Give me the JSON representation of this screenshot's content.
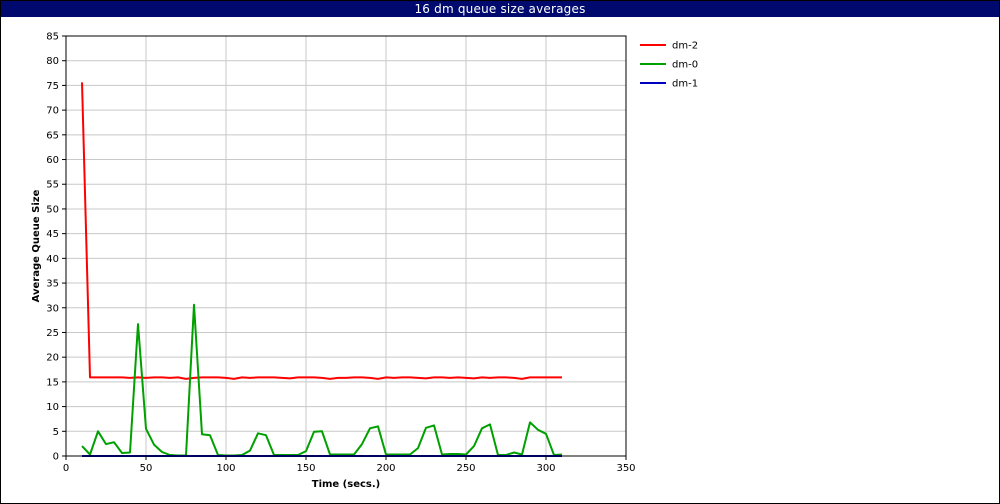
{
  "chart_data": {
    "type": "line",
    "title": "16 dm queue size averages",
    "xlabel": "Time (secs.)",
    "ylabel": "Average Queue Size",
    "xlim": [
      0,
      350
    ],
    "ylim": [
      0,
      85
    ],
    "x_ticks": [
      0,
      50,
      100,
      150,
      200,
      250,
      300,
      350
    ],
    "y_ticks": [
      0,
      5,
      10,
      15,
      20,
      25,
      30,
      35,
      40,
      45,
      50,
      55,
      60,
      65,
      70,
      75,
      80,
      85
    ],
    "grid": true,
    "legend_position": "right",
    "series": [
      {
        "name": "dm-2",
        "color": "#ff0000",
        "x": [
          10,
          15,
          20,
          25,
          30,
          35,
          40,
          45,
          50,
          55,
          60,
          65,
          70,
          75,
          80,
          85,
          90,
          95,
          100,
          105,
          110,
          115,
          120,
          125,
          130,
          135,
          140,
          145,
          150,
          155,
          160,
          165,
          170,
          175,
          180,
          185,
          190,
          195,
          200,
          205,
          210,
          215,
          220,
          225,
          230,
          235,
          240,
          245,
          250,
          255,
          260,
          265,
          270,
          275,
          280,
          285,
          290,
          295,
          300,
          305,
          310
        ],
        "values": [
          75.6,
          15.9,
          15.9,
          15.9,
          15.9,
          15.9,
          15.8,
          15.9,
          15.8,
          15.9,
          15.9,
          15.8,
          15.9,
          15.6,
          15.8,
          15.9,
          15.9,
          15.9,
          15.8,
          15.6,
          15.9,
          15.8,
          15.9,
          15.9,
          15.9,
          15.8,
          15.7,
          15.9,
          15.9,
          15.9,
          15.8,
          15.6,
          15.8,
          15.8,
          15.9,
          15.9,
          15.8,
          15.6,
          15.9,
          15.8,
          15.9,
          15.9,
          15.8,
          15.7,
          15.9,
          15.9,
          15.8,
          15.9,
          15.8,
          15.7,
          15.9,
          15.8,
          15.9,
          15.9,
          15.8,
          15.6,
          15.9,
          15.9,
          15.9,
          15.9,
          15.9
        ]
      },
      {
        "name": "dm-0",
        "color": "#00a000",
        "x": [
          10,
          15,
          20,
          25,
          30,
          35,
          40,
          45,
          50,
          55,
          60,
          65,
          70,
          75,
          80,
          85,
          90,
          95,
          100,
          105,
          110,
          115,
          120,
          125,
          130,
          135,
          140,
          145,
          150,
          155,
          160,
          165,
          170,
          175,
          180,
          185,
          190,
          195,
          200,
          205,
          210,
          215,
          220,
          225,
          230,
          235,
          240,
          245,
          250,
          255,
          260,
          265,
          270,
          275,
          280,
          285,
          290,
          295,
          300,
          305,
          310
        ],
        "values": [
          2.0,
          0.3,
          5.0,
          2.4,
          2.8,
          0.6,
          0.7,
          26.7,
          5.5,
          2.3,
          0.8,
          0.2,
          0.1,
          0.1,
          30.6,
          4.4,
          4.2,
          0.2,
          0.1,
          0.1,
          0.2,
          1.1,
          4.6,
          4.2,
          0.2,
          0.2,
          0.2,
          0.2,
          1.0,
          4.9,
          5.0,
          0.3,
          0.3,
          0.3,
          0.3,
          2.4,
          5.6,
          6.0,
          0.3,
          0.3,
          0.3,
          0.3,
          1.6,
          5.7,
          6.2,
          0.3,
          0.4,
          0.4,
          0.3,
          2.0,
          5.6,
          6.4,
          0.2,
          0.2,
          0.7,
          0.3,
          6.8,
          5.3,
          4.5,
          0.2,
          0.3
        ]
      },
      {
        "name": "dm-1",
        "color": "#0000c0",
        "x": [
          10,
          310
        ],
        "values": [
          0,
          0
        ]
      }
    ]
  }
}
